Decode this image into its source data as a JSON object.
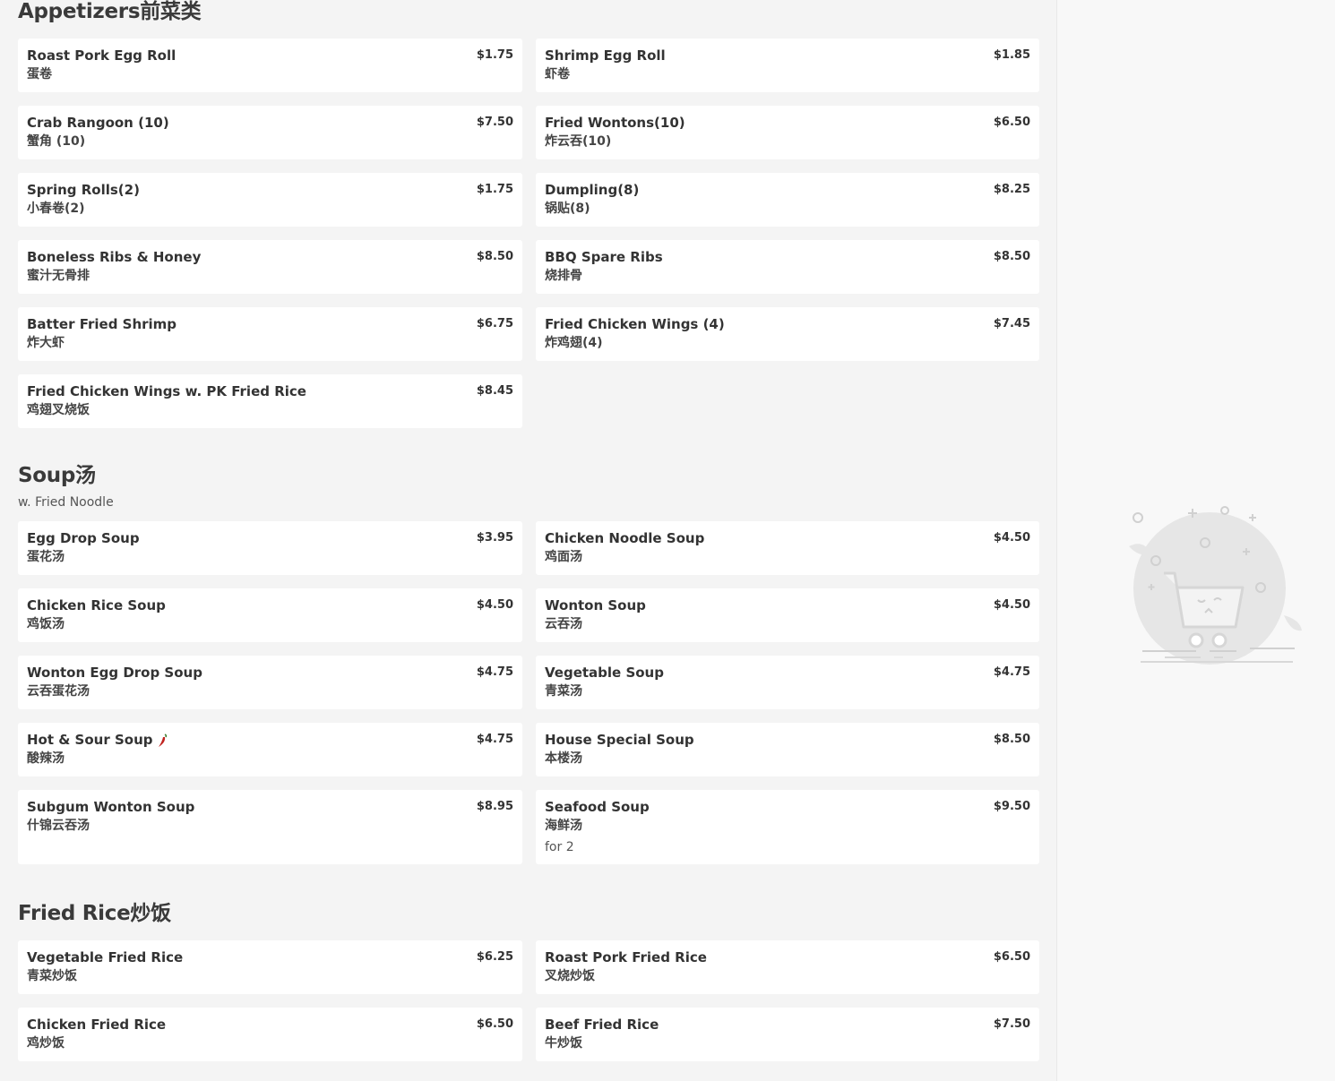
{
  "sections": [
    {
      "title": "Appetizers前菜类",
      "description": "",
      "items": [
        {
          "name": "Roast Pork Egg Roll",
          "cn": "蛋卷",
          "price": "$1.75"
        },
        {
          "name": "Shrimp Egg Roll",
          "cn": "虾卷",
          "price": "$1.85"
        },
        {
          "name": "Crab Rangoon (10)",
          "cn": "蟹角 (10)",
          "price": "$7.50"
        },
        {
          "name": "Fried Wontons(10)",
          "cn": "炸云吞(10)",
          "price": "$6.50"
        },
        {
          "name": "Spring Rolls(2)",
          "cn": "小春卷(2)",
          "price": "$1.75"
        },
        {
          "name": "Dumpling(8)",
          "cn": "锅贴(8)",
          "price": "$8.25"
        },
        {
          "name": "Boneless Ribs & Honey",
          "cn": "蜜汁无骨排",
          "price": "$8.50"
        },
        {
          "name": "BBQ Spare Ribs",
          "cn": "烧排骨",
          "price": "$8.50"
        },
        {
          "name": "Batter Fried Shrimp",
          "cn": "炸大虾",
          "price": "$6.75"
        },
        {
          "name": "Fried Chicken Wings (4)",
          "cn": "炸鸡翅(4)",
          "price": "$7.45"
        },
        {
          "name": "Fried Chicken Wings w. PK Fried Rice",
          "cn": "鸡翅叉烧饭",
          "price": "$8.45"
        }
      ]
    },
    {
      "title": "Soup汤",
      "description": "w. Fried Noodle",
      "items": [
        {
          "name": "Egg Drop Soup",
          "cn": "蛋花汤",
          "price": "$3.95"
        },
        {
          "name": "Chicken Noodle Soup",
          "cn": "鸡面汤",
          "price": "$4.50"
        },
        {
          "name": "Chicken Rice Soup",
          "cn": "鸡饭汤",
          "price": "$4.50"
        },
        {
          "name": "Wonton Soup",
          "cn": "云吞汤",
          "price": "$4.50"
        },
        {
          "name": "Wonton Egg Drop Soup",
          "cn": "云吞蛋花汤",
          "price": "$4.75"
        },
        {
          "name": "Vegetable Soup",
          "cn": "青菜汤",
          "price": "$4.75"
        },
        {
          "name": "Hot & Sour Soup",
          "cn": "酸辣汤",
          "price": "$4.75",
          "spicy": true
        },
        {
          "name": "House Special Soup",
          "cn": "本楼汤",
          "price": "$8.50"
        },
        {
          "name": "Subgum Wonton Soup",
          "cn": "什锦云吞汤",
          "price": "$8.95"
        },
        {
          "name": "Seafood Soup",
          "cn": "海鲜汤",
          "price": "$9.50",
          "note": "for 2"
        }
      ]
    },
    {
      "title": "Fried Rice炒饭",
      "description": "",
      "items": [
        {
          "name": "Vegetable Fried Rice",
          "cn": "青菜炒饭",
          "price": "$6.25"
        },
        {
          "name": "Roast Pork Fried Rice",
          "cn": "叉烧炒饭",
          "price": "$6.50"
        },
        {
          "name": "Chicken Fried Rice",
          "cn": "鸡炒饭",
          "price": "$6.50"
        },
        {
          "name": "Beef Fried Rice",
          "cn": "牛炒饭",
          "price": "$7.50"
        }
      ]
    }
  ],
  "icons": {
    "spicy": "chili-pepper-icon",
    "empty_cart": "empty-cart-illustration"
  },
  "colors": {
    "background": "#f4f4f4",
    "card": "#ffffff",
    "pepper": "#c0231f",
    "illustration": "#e6e6e6"
  }
}
